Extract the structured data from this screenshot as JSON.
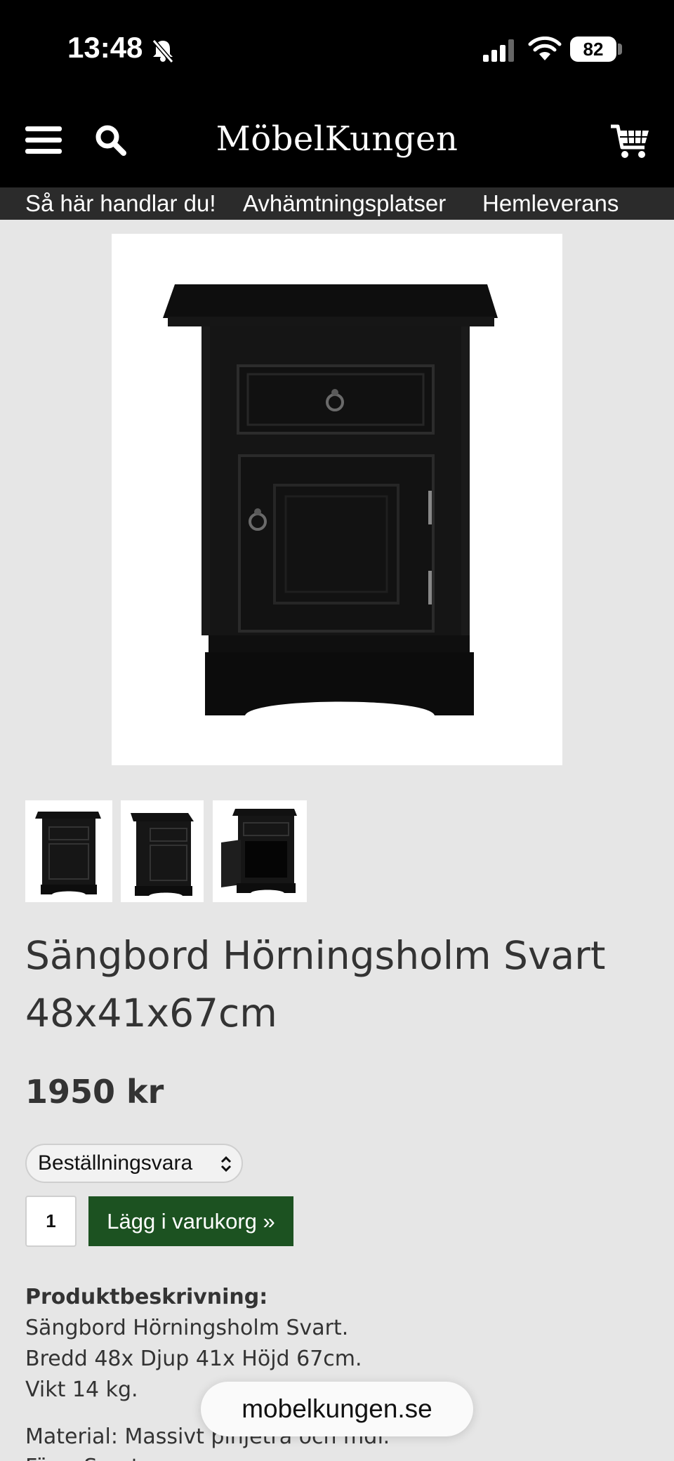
{
  "status_bar": {
    "time": "13:48",
    "battery": "82"
  },
  "header": {
    "logo": "MöbelKungen",
    "icons": [
      "menu-icon",
      "search-icon",
      "cart-icon"
    ]
  },
  "subnav": {
    "items": [
      "Så här handlar du!",
      "Avhämtningsplatser",
      "Hemleverans"
    ]
  },
  "product": {
    "title": "Sängbord Hörningsholm Svart 48x41x67cm",
    "price": "1950 kr",
    "availability": "Beställningsvara",
    "quantity": "1",
    "add_to_cart_label": "Lägg i varukorg »",
    "description_heading": "Produktbeskrivning:",
    "description_lines": [
      "Sängbord Hörningsholm Svart.",
      "Bredd 48x Djup 41x Höjd 67cm.",
      "Vikt 14 kg."
    ],
    "material_line": "Material: Massivt pinjeträ och mdf.",
    "partial_line": "Färg: Svart"
  },
  "browser": {
    "url": "mobelkungen.se"
  },
  "colors": {
    "header_bg": "#000000",
    "subnav_bg": "#2b2b2b",
    "page_bg": "#e6e6e6",
    "button_green": "#1c5221"
  }
}
